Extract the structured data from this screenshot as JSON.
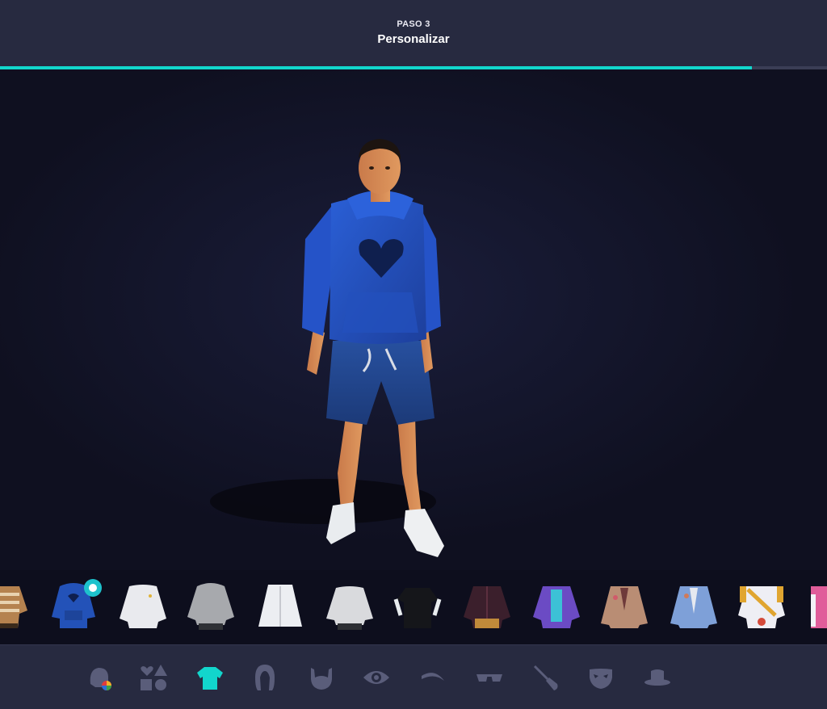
{
  "header": {
    "step_label": "PASO 3",
    "title": "Personalizar"
  },
  "progress": {
    "fraction": 0.909,
    "accent_color": "#12d6cc"
  },
  "carousel": {
    "selected_index": 1,
    "items": [
      "striped-sweater-thumbnail",
      "blue-hoodie-thumbnail",
      "white-sweatshirt-thumbnail",
      "gray-hoodie-thumbnail",
      "white-long-coat-thumbnail",
      "gray-sweater-thumbnail",
      "black-tshirt-thumbnail",
      "dark-plaid-jacket-thumbnail",
      "purple-jacket-thumbnail",
      "tan-suit-jacket-thumbnail",
      "blue-suit-jacket-thumbnail",
      "white-gold-armor-thumbnail",
      "pink-outfit-thumbnail"
    ]
  },
  "categories": {
    "selected": "shirt-icon",
    "items": [
      "skin-tone-icon",
      "shapes-icon",
      "shirt-icon",
      "hair-icon",
      "beard-icon",
      "eye-icon",
      "eyebrow-icon",
      "glasses-icon",
      "makeup-brush-icon",
      "mask-icon",
      "hat-icon"
    ],
    "inactive_color": "#5a5d7a",
    "active_color": "#12d6cc"
  }
}
